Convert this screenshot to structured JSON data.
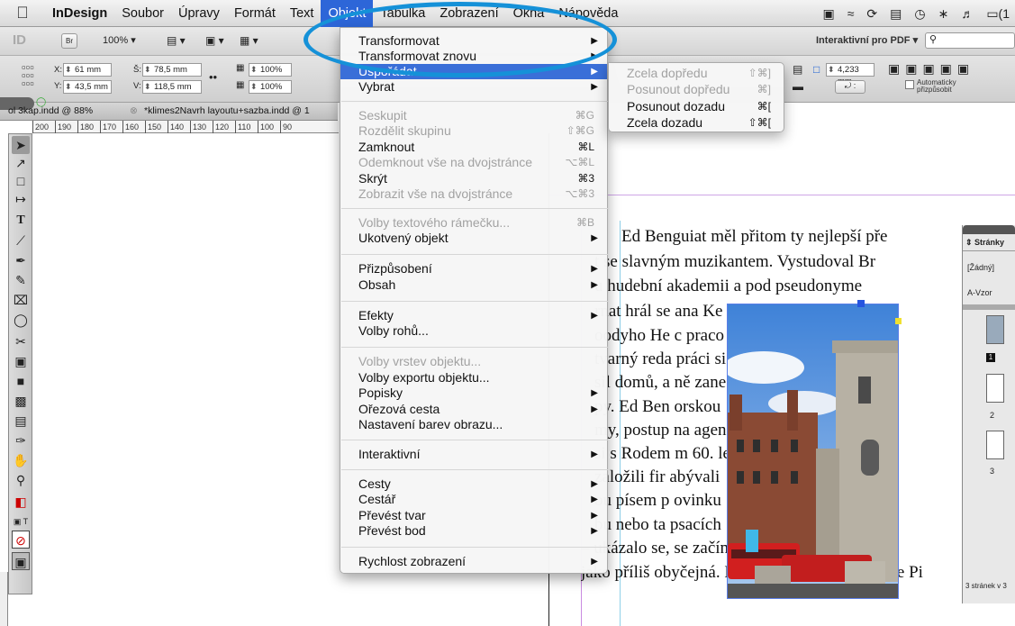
{
  "menubar": {
    "app": "InDesign",
    "items": [
      "Soubor",
      "Úpravy",
      "Formát",
      "Text",
      "Objekt",
      "Tabulka",
      "Zobrazení",
      "Okna",
      "Nápověda"
    ],
    "active": "Objekt",
    "status_tail": "(1"
  },
  "control": {
    "zoom": "100%",
    "workspace": "Interaktivní pro PDF ▾",
    "x_label": "X:",
    "x_value": "61 mm",
    "y_label": "Y:",
    "y_value": "43,5 mm",
    "w_label": "Š:",
    "w_value": "78,5 mm",
    "h_label": "V:",
    "h_value": "118,5 mm",
    "scale1": "100%",
    "scale2": "100%",
    "stroke": "4,233 mm",
    "auto_fit": "Automaticky přizpůsobit"
  },
  "tabs": [
    "ol 3kap.indd @ 88%",
    "*klimes2Navrh layoutu+sazba.indd @ 1"
  ],
  "ruler_left": [
    "200",
    "190",
    "180",
    "170",
    "160",
    "150",
    "140",
    "130",
    "120",
    "110",
    "100",
    "90"
  ],
  "ruler_right": [
    "30",
    "40",
    "50",
    "60",
    "70",
    "80",
    "90",
    "100",
    "110",
    "120",
    "130",
    "140",
    "150",
    "160",
    "170",
    "18"
  ],
  "menu": {
    "items": [
      {
        "label": "Transformovat",
        "shortcut": "",
        "arrow": true,
        "disabled": false
      },
      {
        "label": "Transformovat znovu",
        "shortcut": "",
        "arrow": true,
        "disabled": false
      },
      {
        "label": "Uspořádat",
        "shortcut": "",
        "arrow": true,
        "disabled": false,
        "highlight": true
      },
      {
        "label": "Vybrat",
        "shortcut": "",
        "arrow": true,
        "disabled": false
      },
      {
        "label": "Seskupit",
        "shortcut": "⌘G",
        "disabled": true
      },
      {
        "label": "Rozdělit skupinu",
        "shortcut": "⇧⌘G",
        "disabled": true
      },
      {
        "label": "Zamknout",
        "shortcut": "⌘L",
        "disabled": false
      },
      {
        "label": "Odemknout vše na dvojstránce",
        "shortcut": "⌥⌘L",
        "disabled": true
      },
      {
        "label": "Skrýt",
        "shortcut": "⌘3",
        "disabled": false
      },
      {
        "label": "Zobrazit vše na dvojstránce",
        "shortcut": "⌥⌘3",
        "disabled": true
      },
      {
        "label": "Volby textového rámečku...",
        "shortcut": "⌘B",
        "disabled": true
      },
      {
        "label": "Ukotvený objekt",
        "arrow": true,
        "disabled": false
      },
      {
        "label": "Přizpůsobení",
        "arrow": true,
        "disabled": false
      },
      {
        "label": "Obsah",
        "arrow": true,
        "disabled": false
      },
      {
        "label": "Efekty",
        "arrow": true,
        "disabled": false
      },
      {
        "label": "Volby rohů...",
        "disabled": false
      },
      {
        "label": "Volby vrstev objektu...",
        "disabled": true
      },
      {
        "label": "Volby exportu objektu...",
        "disabled": false
      },
      {
        "label": "Popisky",
        "arrow": true,
        "disabled": false
      },
      {
        "label": "Ořezová cesta",
        "arrow": true,
        "disabled": false
      },
      {
        "label": "Nastavení barev obrazu...",
        "disabled": false
      },
      {
        "label": "Interaktivní",
        "arrow": true,
        "disabled": false
      },
      {
        "label": "Cesty",
        "arrow": true,
        "disabled": false
      },
      {
        "label": "Cestář",
        "arrow": true,
        "disabled": false
      },
      {
        "label": "Převést tvar",
        "arrow": true,
        "disabled": false
      },
      {
        "label": "Převést bod",
        "arrow": true,
        "disabled": false
      },
      {
        "label": "Rychlost zobrazení",
        "arrow": true,
        "disabled": false
      }
    ]
  },
  "submenu": {
    "items": [
      {
        "label": "Zcela dopředu",
        "shortcut": "⇧⌘]",
        "disabled": true
      },
      {
        "label": "Posunout dopředu",
        "shortcut": "⌘]",
        "disabled": true
      },
      {
        "label": "Posunout dozadu",
        "shortcut": "⌘[",
        "disabled": false
      },
      {
        "label": "Zcela dozadu",
        "shortcut": "⇧⌘[",
        "disabled": false
      }
    ]
  },
  "document": {
    "lines": [
      "Ed Benguiat měl přitom ty nejlepší pře",
      "t se slavným muzikantem. Vystudoval Br",
      "u hudební akademii a pod pseudonyme",
      "rnat hrál se                         ana Ke",
      "oodyho He                         c praco",
      "tvarný reda                        práci si",
      "sil domů, a                        ně zane",
      "py. Ed Ben                         orskou",
      "my, postup                         na agen",
      "si s Rodem                         m 60. le",
      "založili fir                        abývali",
      "ou písem p                         ovinku",
      "bu nebo ta                         psacích",
      "– ukázalo se,                      se začín",
      "jako příliš obyčejná. Kvalitní písma s produkce Pi"
    ]
  },
  "pages_panel": {
    "title": "Stránky",
    "none": "[Žádný]",
    "master": "A-Vzor",
    "page1": "1",
    "page2": "2",
    "page3": "3",
    "footer": "3 stránek v 3"
  },
  "colors": {
    "menu_highlight": "#3a6fd8",
    "ellipse": "#1591d8",
    "frame": "#5a7ee8"
  }
}
